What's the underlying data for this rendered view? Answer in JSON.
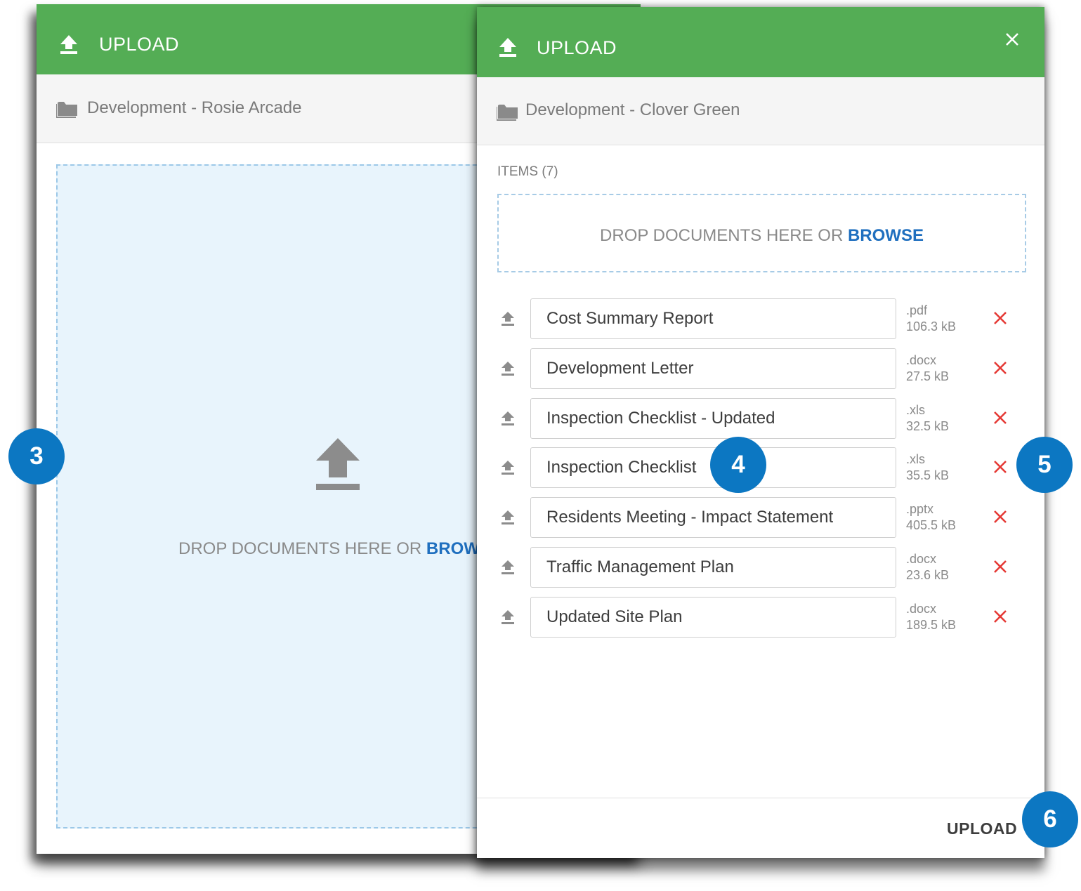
{
  "back_dialog": {
    "title": "UPLOAD",
    "folder": "Development - Rosie Arcade",
    "drop_text": "DROP DOCUMENTS HERE OR ",
    "browse_label": "BROWSE"
  },
  "front_dialog": {
    "title": "UPLOAD",
    "folder": "Development - Clover Green",
    "items_label": "ITEMS (7)",
    "drop_text": "DROP DOCUMENTS HERE OR ",
    "browse_label": "BROWSE",
    "files": [
      {
        "name": "Cost Summary Report",
        "ext": ".pdf",
        "size": "106.3 kB"
      },
      {
        "name": "Development Letter",
        "ext": ".docx",
        "size": "27.5 kB"
      },
      {
        "name": "Inspection Checklist - Updated",
        "ext": ".xls",
        "size": "32.5 kB"
      },
      {
        "name": "Inspection Checklist",
        "ext": ".xls",
        "size": "35.5 kB"
      },
      {
        "name": "Residents Meeting - Impact Statement",
        "ext": ".pptx",
        "size": "405.5 kB"
      },
      {
        "name": "Traffic Management Plan",
        "ext": ".docx",
        "size": "23.6 kB"
      },
      {
        "name": "Updated Site Plan",
        "ext": ".docx",
        "size": "189.5 kB"
      }
    ],
    "upload_button": "UPLOAD"
  },
  "callouts": [
    "3",
    "4",
    "5",
    "6"
  ],
  "icons": {
    "upload": "upload-icon",
    "folder": "folder-icon",
    "close": "close-icon",
    "remove": "remove-icon"
  },
  "colors": {
    "header": "#54ad55",
    "accent_link": "#1f6fbf",
    "remove": "#e53935",
    "callout": "#0c77c2",
    "drop_zone": "#e8f4fc"
  }
}
